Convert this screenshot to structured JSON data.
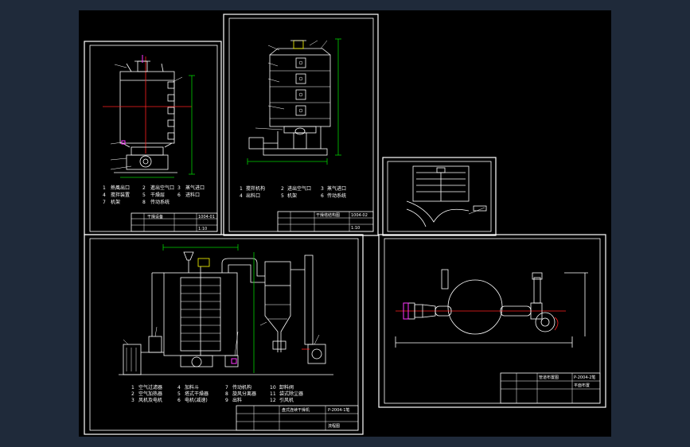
{
  "window": {
    "background": "#1f2a3a",
    "canvas": "#000000"
  },
  "sheet1": {
    "legend": [
      {
        "n": "1",
        "t": "熱風出口"
      },
      {
        "n": "2",
        "t": "進出空气口"
      },
      {
        "n": "3",
        "t": "蒸气进口"
      },
      {
        "n": "4",
        "t": "搅拌装置"
      },
      {
        "n": "5",
        "t": "干燥层"
      },
      {
        "n": "6",
        "t": "进料口"
      },
      {
        "n": "7",
        "t": "机架"
      },
      {
        "n": "8",
        "t": "传动系统"
      }
    ],
    "title_block": {
      "name": "干燥设备",
      "code": "1004-01",
      "scale": "1:10"
    }
  },
  "sheet2": {
    "legend": [
      {
        "n": "1",
        "t": "搅拌机构"
      },
      {
        "n": "2",
        "t": "进出空气口"
      },
      {
        "n": "3",
        "t": "蒸气进口"
      },
      {
        "n": "4",
        "t": "出料口"
      },
      {
        "n": "5",
        "t": "机架"
      },
      {
        "n": "6",
        "t": "传动系统"
      }
    ],
    "title_block": {
      "name": "干燥塔结构图",
      "code": "1004-02",
      "scale": "1:10"
    }
  },
  "sheet4": {
    "legend": [
      {
        "n": "1",
        "t": "空气过滤器"
      },
      {
        "n": "2",
        "t": "空气加热器"
      },
      {
        "n": "3",
        "t": "风机及电机"
      },
      {
        "n": "4",
        "t": "加料斗"
      },
      {
        "n": "5",
        "t": "塔式干燥器"
      },
      {
        "n": "6",
        "t": "电机(减速)"
      },
      {
        "n": "7",
        "t": "传动机构"
      },
      {
        "n": "8",
        "t": "旋风分离器"
      },
      {
        "n": "9",
        "t": "出料"
      },
      {
        "n": "10",
        "t": "卸料阀"
      },
      {
        "n": "11",
        "t": "袋式除尘器"
      },
      {
        "n": "12",
        "t": "引风机"
      }
    ],
    "title_block": {
      "name": "盘式连续干燥机",
      "code": "P-2004-1笔",
      "scale": "流程图"
    }
  },
  "sheet5": {
    "title_block": {
      "name": "管道布置图",
      "code": "P-2004-2笔",
      "scale": "平面布置"
    }
  }
}
